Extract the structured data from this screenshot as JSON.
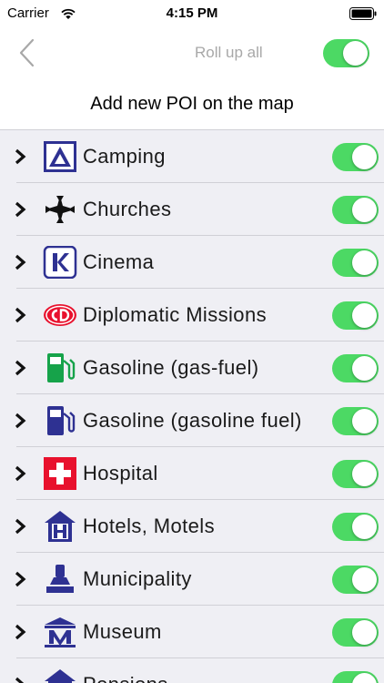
{
  "status": {
    "carrier": "Carrier",
    "time": "4:15 PM"
  },
  "nav": {
    "rollup_label": "Roll up all",
    "rollup_on": true
  },
  "header": {
    "title": "Add new POI on the map"
  },
  "colors": {
    "toggle_on": "#4cd964",
    "icon_blue": "#2e3192",
    "icon_red": "#e8112d",
    "icon_green": "#16a34a"
  },
  "items": [
    {
      "label": "Camping",
      "icon": "camping-tent-icon",
      "enabled": true
    },
    {
      "label": "Churches",
      "icon": "church-cross-icon",
      "enabled": true
    },
    {
      "label": "Cinema",
      "icon": "cinema-k-icon",
      "enabled": true
    },
    {
      "label": "Diplomatic Missions",
      "icon": "cd-badge-icon",
      "enabled": true
    },
    {
      "label": "Gasoline (gas-fuel)",
      "icon": "gas-pump-green-icon",
      "enabled": true
    },
    {
      "label": "Gasoline (gasoline fuel)",
      "icon": "gas-pump-blue-icon",
      "enabled": true
    },
    {
      "label": "Hospital",
      "icon": "hospital-cross-icon",
      "enabled": true
    },
    {
      "label": "Hotels, Motels",
      "icon": "hotel-h-icon",
      "enabled": true
    },
    {
      "label": "Municipality",
      "icon": "municipality-stamp-icon",
      "enabled": true
    },
    {
      "label": "Museum",
      "icon": "museum-m-icon",
      "enabled": true
    },
    {
      "label": "Pensions",
      "icon": "pension-house-icon",
      "enabled": true
    }
  ]
}
